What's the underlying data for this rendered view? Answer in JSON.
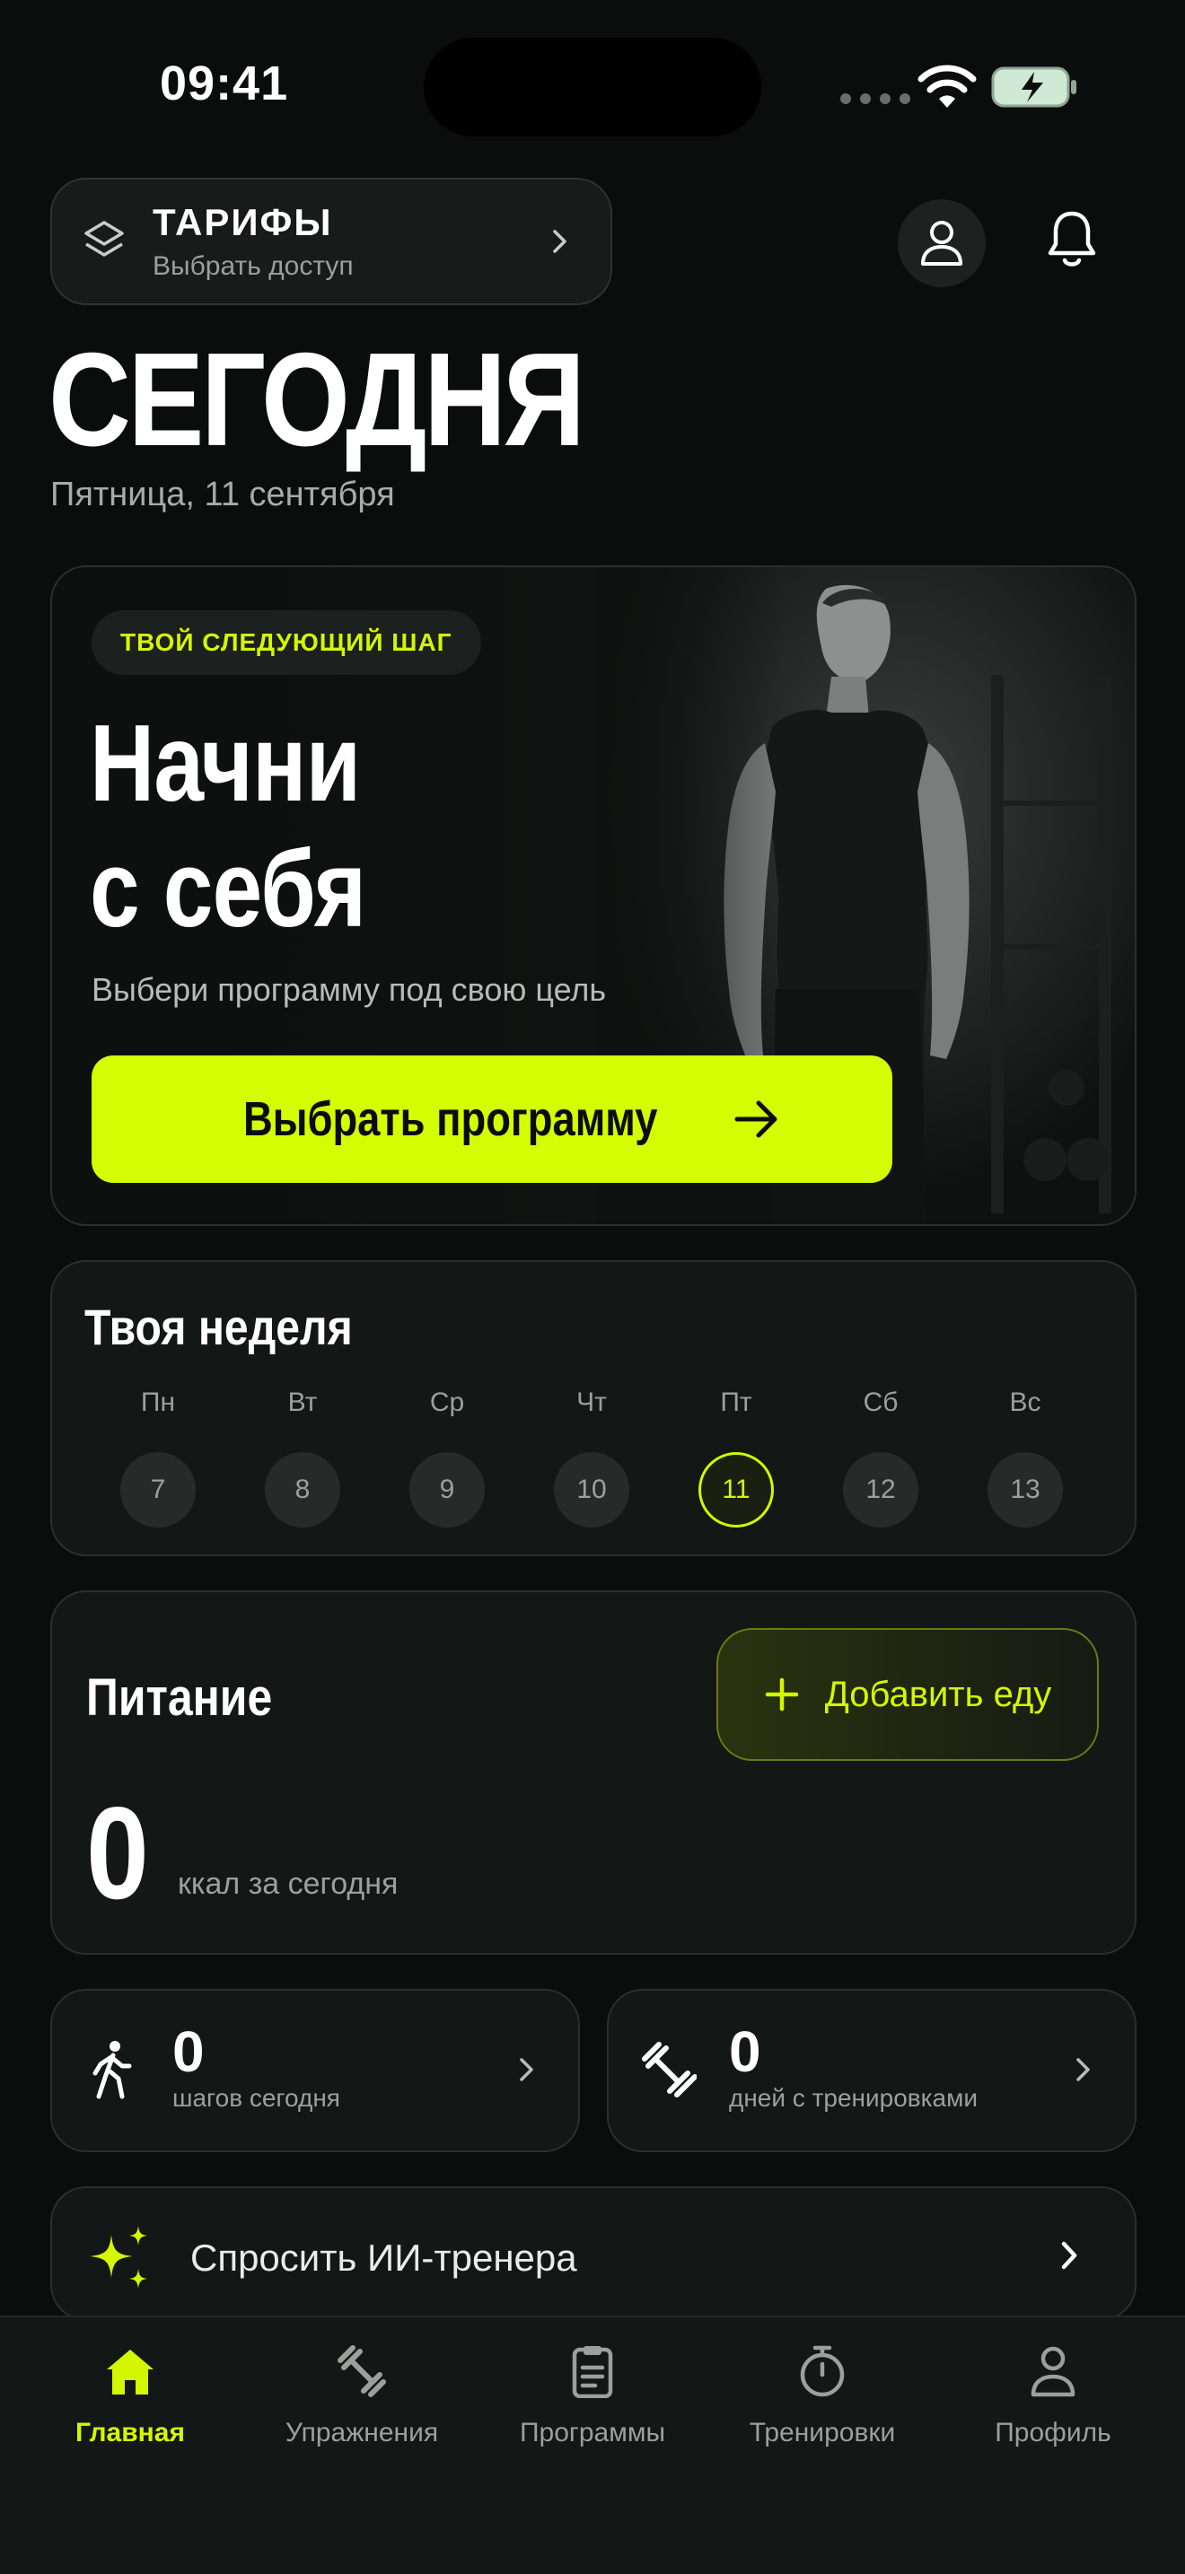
{
  "status_bar": {
    "time": "09:41"
  },
  "header": {
    "tariff_title": "ТАРИФЫ",
    "tariff_subtitle": "Выбрать доступ",
    "page_title": "СЕГОДНЯ",
    "date": "Пятница, 11 сентября"
  },
  "hero": {
    "badge": "ТВОЙ СЛЕДУЮЩИЙ ШАГ",
    "headline": "Начни\nс себя",
    "subtitle": "Выбери программу под свою цель",
    "cta_label": "Выбрать программу"
  },
  "week": {
    "title": "Твоя неделя",
    "days": [
      {
        "name": "Пн",
        "date": "7",
        "active": false
      },
      {
        "name": "Вт",
        "date": "8",
        "active": false
      },
      {
        "name": "Ср",
        "date": "9",
        "active": false
      },
      {
        "name": "Чт",
        "date": "10",
        "active": false
      },
      {
        "name": "Пт",
        "date": "11",
        "active": true
      },
      {
        "name": "Сб",
        "date": "12",
        "active": false
      },
      {
        "name": "Вс",
        "date": "13",
        "active": false
      }
    ]
  },
  "nutrition": {
    "title": "Питание",
    "add_label": "Добавить еду",
    "kcal_value": "0",
    "kcal_label": "ккал за сегодня"
  },
  "stats": {
    "steps_value": "0",
    "steps_label": "шагов сегодня",
    "days_value": "0",
    "days_label": "дней с тренировками"
  },
  "ai": {
    "label": "Спросить ИИ-тренера"
  },
  "tabs": [
    {
      "label": "Главная",
      "icon": "home-icon",
      "active": true
    },
    {
      "label": "Упражнения",
      "icon": "dumbbell-icon",
      "active": false
    },
    {
      "label": "Программы",
      "icon": "clipboard-icon",
      "active": false
    },
    {
      "label": "Тренировки",
      "icon": "stopwatch-icon",
      "active": false
    },
    {
      "label": "Профиль",
      "icon": "person-icon",
      "active": false
    }
  ],
  "colors": {
    "accent": "#d4fc02",
    "background": "#0b0d0c",
    "card": "#131716",
    "muted_text": "#9aa09c"
  }
}
